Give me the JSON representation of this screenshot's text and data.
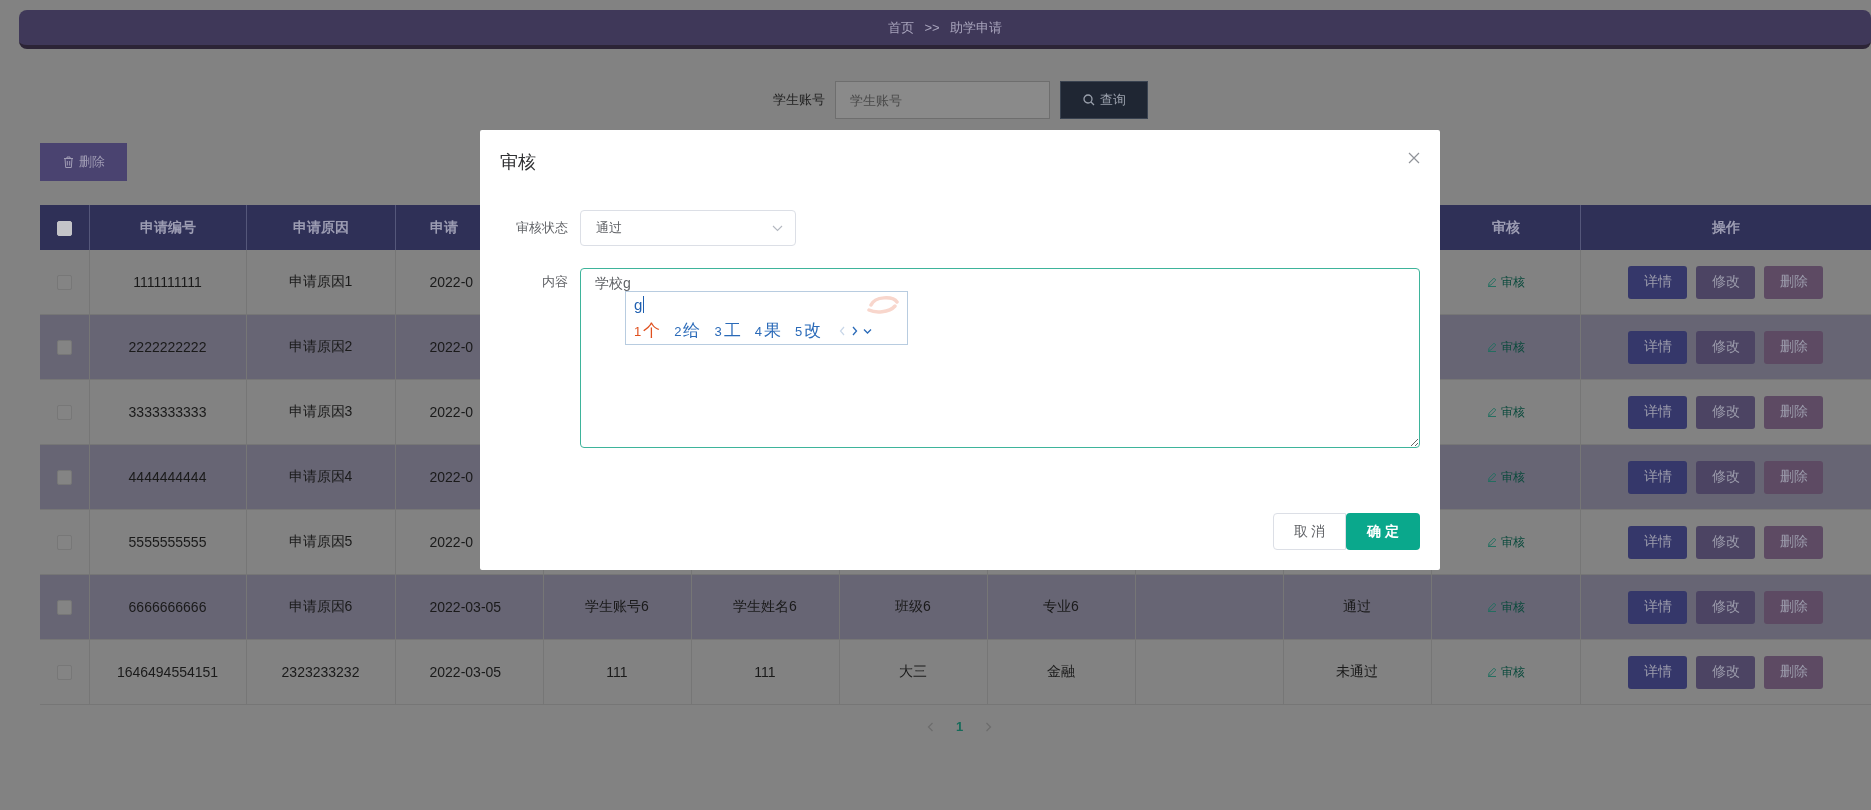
{
  "breadcrumb": {
    "home": "首页",
    "separator": ">>",
    "current": "助学申请"
  },
  "search": {
    "label": "学生账号",
    "placeholder": "学生账号",
    "button": "查询"
  },
  "toolbar": {
    "delete_button": "删除"
  },
  "table": {
    "header_checked": false,
    "columns": [
      "申请编号",
      "申请原因",
      "申请"
    ],
    "review_column": "审核",
    "actions_column": "操作",
    "rows": [
      {
        "checked": false,
        "cells": [
          "1111111111",
          "申请原因1",
          "2022-0"
        ],
        "review": "审核",
        "actions": [
          "详情",
          "修改",
          "删除"
        ]
      },
      {
        "checked": false,
        "cells": [
          "2222222222",
          "申请原因2",
          "2022-0"
        ],
        "review": "审核",
        "actions": [
          "详情",
          "修改",
          "删除"
        ]
      },
      {
        "checked": false,
        "cells": [
          "3333333333",
          "申请原因3",
          "2022-0"
        ],
        "review": "审核",
        "actions": [
          "详情",
          "修改",
          "删除"
        ]
      },
      {
        "checked": false,
        "cells": [
          "4444444444",
          "申请原因4",
          "2022-0"
        ],
        "review": "审核",
        "actions": [
          "详情",
          "修改",
          "删除"
        ]
      },
      {
        "checked": false,
        "cells": [
          "5555555555",
          "申请原因5",
          "2022-0"
        ],
        "review": "审核",
        "actions": [
          "详情",
          "修改",
          "删除"
        ]
      },
      {
        "checked": false,
        "cells": [
          "6666666666",
          "申请原因6",
          "2022-03-05",
          "学生账号6",
          "学生姓名6",
          "班级6",
          "专业6"
        ],
        "status": "通过",
        "review": "审核",
        "actions": [
          "详情",
          "修改",
          "删除"
        ]
      },
      {
        "checked": false,
        "cells": [
          "1646494554151",
          "2323233232",
          "2022-03-05",
          "111",
          "111",
          "大三",
          "金融"
        ],
        "status": "未通过",
        "review": "审核",
        "actions": [
          "详情",
          "修改",
          "删除"
        ]
      }
    ]
  },
  "pagination": {
    "pages": [
      {
        "label": "1",
        "selected": true
      }
    ]
  },
  "dialog": {
    "title": "审核",
    "status_label": "审核状态",
    "status_value": "通过",
    "content_label": "内容",
    "content_value": "学校g",
    "buttons": [
      "取 消",
      "确 定"
    ]
  },
  "ime": {
    "composition": "g",
    "candidates": [
      {
        "number": "1",
        "text": "个",
        "selected": true
      },
      {
        "number": "2",
        "text": "给",
        "selected": false
      },
      {
        "number": "3",
        "text": "工",
        "selected": false
      },
      {
        "number": "4",
        "text": "果",
        "selected": false
      },
      {
        "number": "5",
        "text": "改",
        "selected": false
      }
    ]
  }
}
